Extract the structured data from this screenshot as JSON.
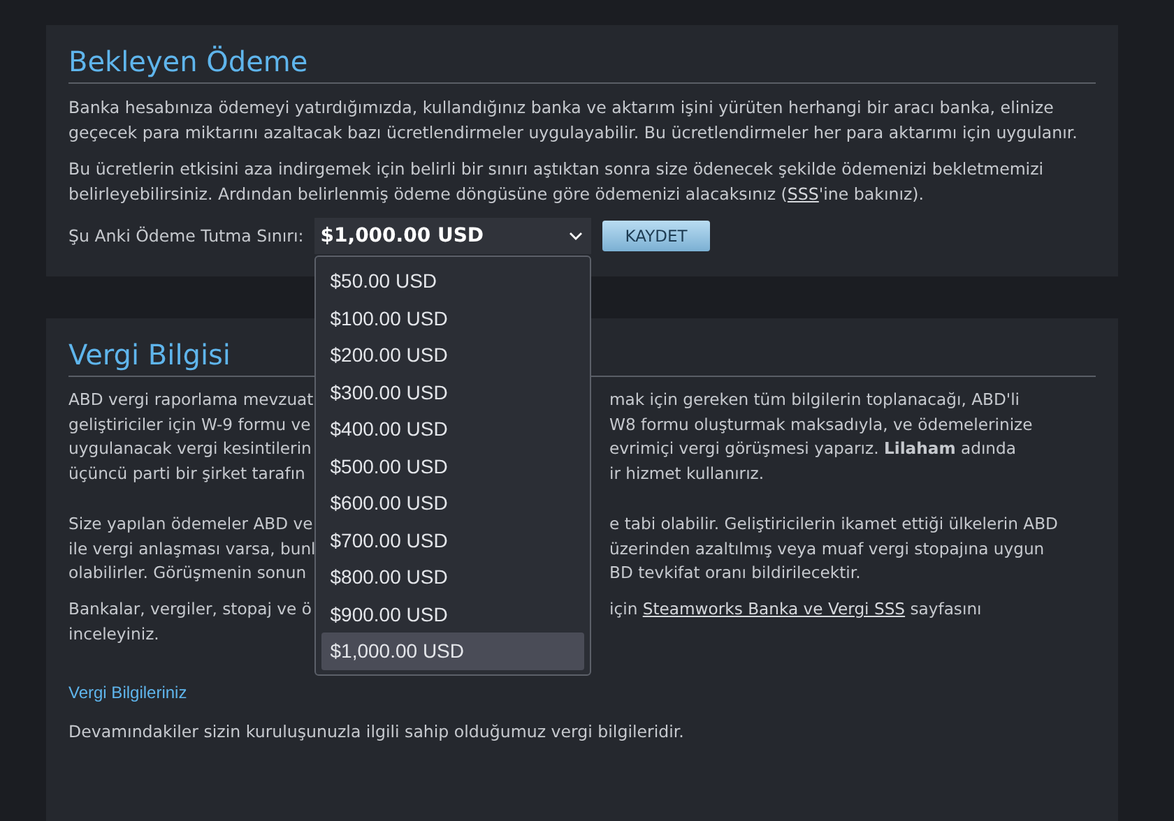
{
  "pending_payment": {
    "title": "Bekleyen Ödeme",
    "paragraphs": [
      {
        "before": "Banka hesabınıza ödemeyi yatırdığımızda, kullandığınız banka ve aktarım işini yürüten herhangi bir aracı banka, elinize geçecek para miktarını azaltacak bazı ücretlendirmeler uygulayabilir. Bu ücretlendirmeler her para aktarımı için uygulanır."
      },
      {
        "before": "Bu ücretlerin etkisini aza indirgemek için belirli bir sınırı aştıktan sonra size ödenecek şekilde ödemenizi bekletmemizi belirleyebilirsiniz. Ardından belirlenmiş ödeme döngüsüne göre ödemenizi alacaksınız (",
        "link": "SSS",
        "after": "'ine bakınız)."
      }
    ],
    "threshold": {
      "label": "Şu Anki Ödeme Tutma Sınırı:",
      "value": "$1,000.00 USD",
      "expanded": true,
      "save_button": "KAYDET",
      "options": [
        {
          "label": "$50.00 USD",
          "selected": false
        },
        {
          "label": "$100.00 USD",
          "selected": false
        },
        {
          "label": "$200.00 USD",
          "selected": false
        },
        {
          "label": "$300.00 USD",
          "selected": false
        },
        {
          "label": "$400.00 USD",
          "selected": false
        },
        {
          "label": "$500.00 USD",
          "selected": false
        },
        {
          "label": "$600.00 USD",
          "selected": false
        },
        {
          "label": "$700.00 USD",
          "selected": false
        },
        {
          "label": "$800.00 USD",
          "selected": false
        },
        {
          "label": "$900.00 USD",
          "selected": false
        },
        {
          "label": "$1,000.00 USD",
          "selected": true
        }
      ]
    }
  },
  "tax_info": {
    "title": "Vergi Bilgisi",
    "paragraphs": [
      {
        "lines": [
          {
            "left": "ABD vergi raporlama mevzuat",
            "right": "mak için gereken tüm bilgilerin toplanacağı, ABD'li"
          },
          {
            "left": "geliştiriciler için W-9 formu ve",
            "right": "W8 formu oluşturmak maksadıyla, ve ödemelerinize"
          },
          {
            "left": "uygulanacak vergi kesintilerin",
            "right": "evrimiçi vergi görüşmesi yaparız. **Lilaham** adında"
          },
          {
            "left": "üçüncü parti bir şirket tarafın",
            "right": "ir hizmet kullanırız."
          }
        ]
      },
      {
        "lines": [
          {
            "left": "Size yapılan ödemeler ABD ve",
            "right": "e tabi olabilir. Geliştiricilerin ikamet ettiği ülkelerin ABD"
          },
          {
            "left": "ile vergi anlaşması varsa, bunl",
            "right": "üzerinden azaltılmış veya muaf vergi stopajına uygun"
          },
          {
            "left": "olabilirler. Görüşmenin sonun",
            "right": "BD tevkifat oranı bildirilecektir."
          }
        ]
      },
      {
        "lines": [
          {
            "left": "Bankalar, vergiler, stopaj ve ö",
            "right": "için",
            "link": "Steamworks Banka ve Vergi SSS",
            "after": "sayfasını"
          },
          {
            "left": "inceleyiniz."
          }
        ]
      }
    ],
    "subtitle": "Vergi Bilgileriniz",
    "note": "Devamındakiler sizin kuruluşunuzla ilgili sahip olduğumuz vergi bilgileridir."
  }
}
